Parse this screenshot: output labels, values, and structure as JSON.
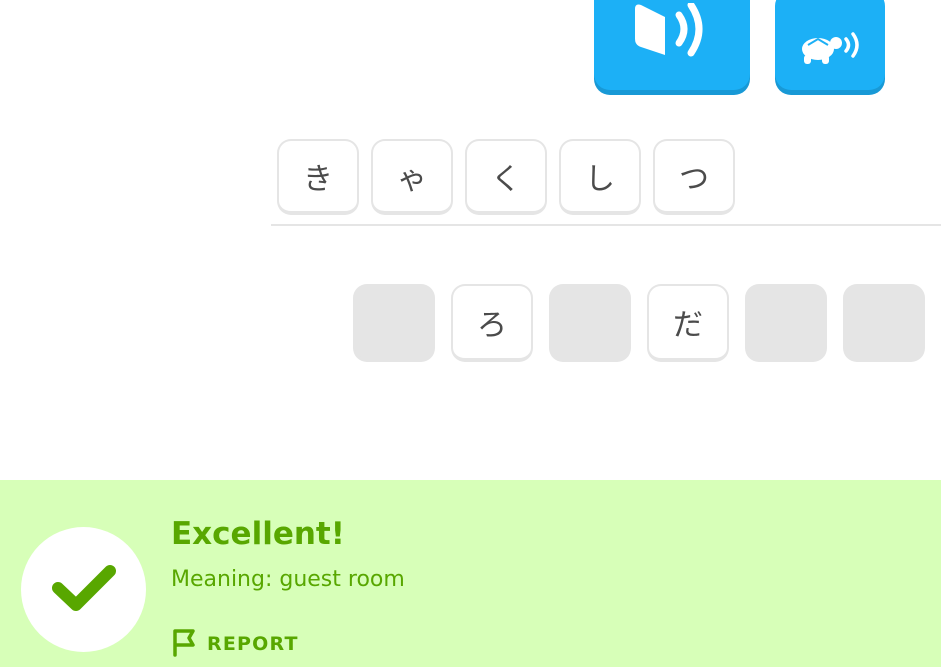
{
  "audio": {
    "normal_icon": "speaker-icon",
    "slow_icon": "turtle-speaker-icon",
    "color": "#1cb0f6"
  },
  "answer": {
    "tiles": [
      "き",
      "ゃ",
      "く",
      "し",
      "つ"
    ]
  },
  "word_bank": {
    "tiles": [
      {
        "label": "",
        "used": true
      },
      {
        "label": "ろ",
        "used": false
      },
      {
        "label": "",
        "used": true
      },
      {
        "label": "だ",
        "used": false
      },
      {
        "label": "",
        "used": true
      },
      {
        "label": "",
        "used": true
      }
    ]
  },
  "feedback": {
    "title": "Excellent!",
    "meaning": "Meaning: guest room",
    "report_label": "REPORT",
    "report_icon": "flag-icon",
    "status_icon": "checkmark-icon",
    "color": "#58a700",
    "background": "#d7ffb8"
  }
}
